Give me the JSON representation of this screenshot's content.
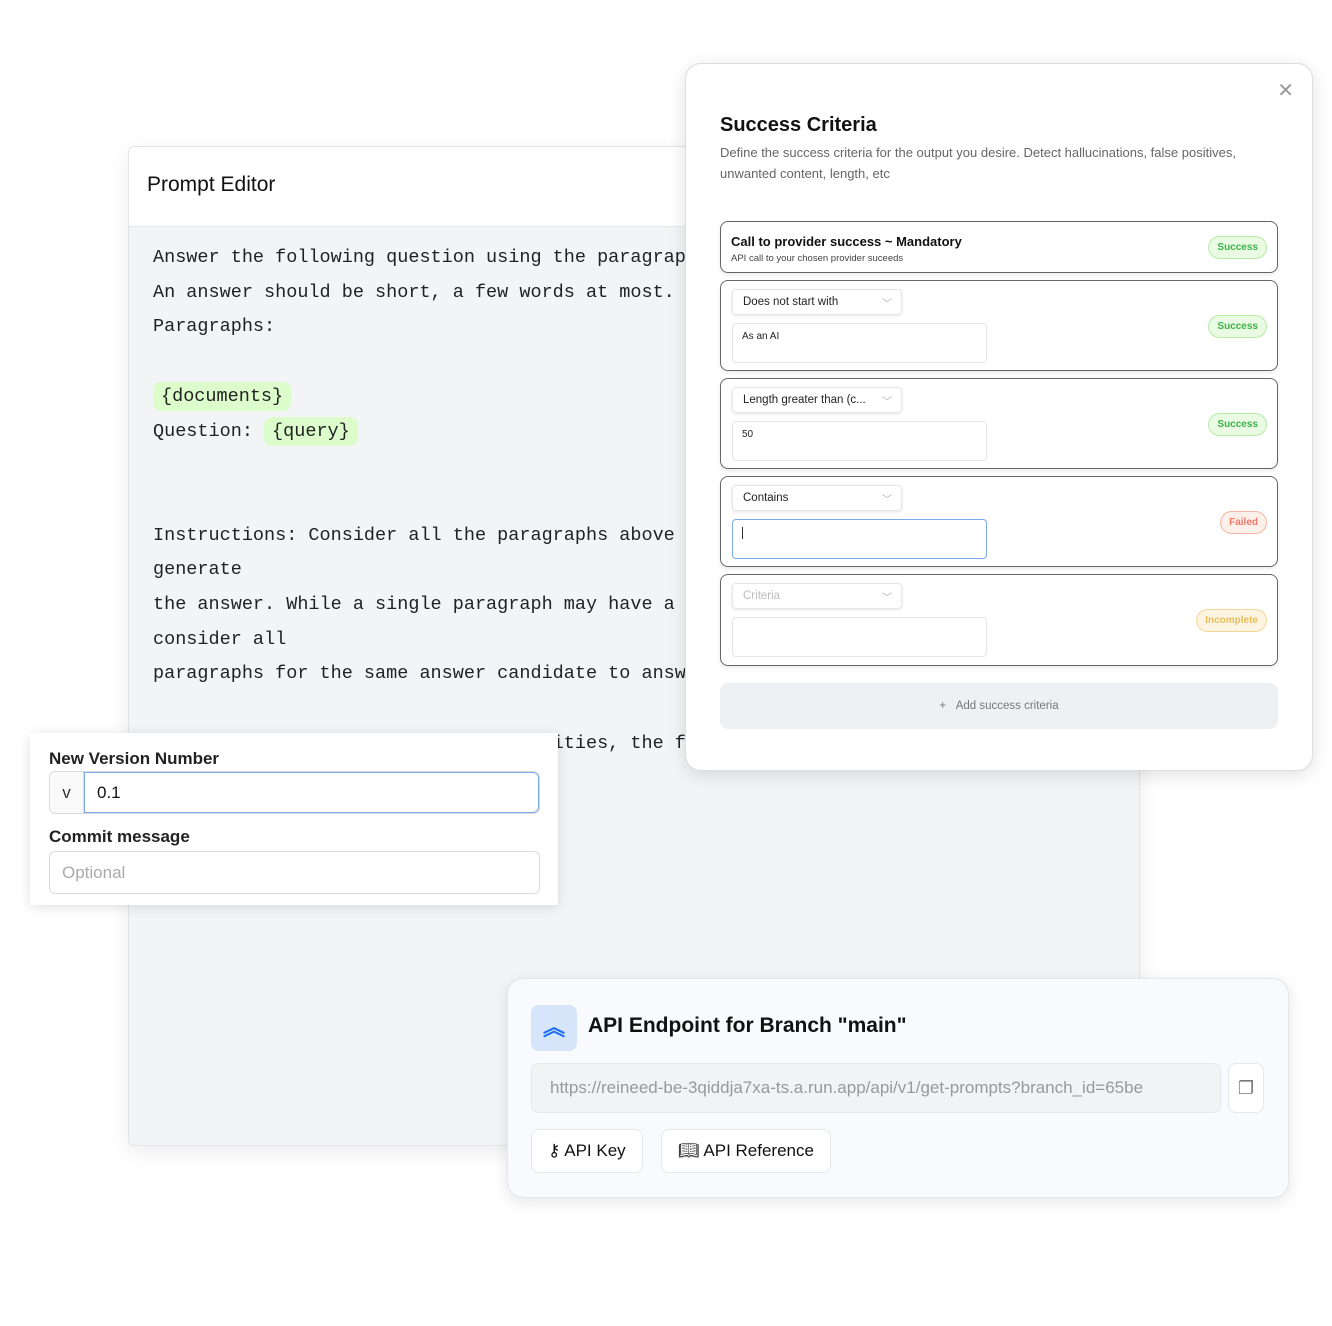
{
  "editor": {
    "title": "Prompt Editor",
    "lines": [
      "Answer the following question using the paragraphs",
      "An answer should be short, a few words at most.",
      "Paragraphs:",
      "",
      "{documents}",
      "Question: {query}",
      "",
      "Instructions: Consider all the paragraphs above",
      "generate",
      "the answer. While a single paragraph may have a",
      "consider all",
      "paragraphs for the same answer candidate to answ",
      "",
      "After having considered all possibilities, the f"
    ],
    "var_documents": "{documents}",
    "question_label": "Question: ",
    "var_query": "{query}"
  },
  "success_criteria": {
    "title": "Success Criteria",
    "description": "Define the success criteria for the output you desire. Detect hallucinations, false positives, unwanted content, length, etc",
    "close_icon": "close-icon",
    "mandatory": {
      "title": "Call to provider success ~ Mandatory",
      "subtitle": "API call to your chosen provider suceeds",
      "status": "Success"
    },
    "items": [
      {
        "criteria": "Does not start with",
        "value": "As an AI",
        "status": "Success"
      },
      {
        "criteria": "Length greater than (c...",
        "value": "50",
        "status": "Success"
      },
      {
        "criteria": "Contains",
        "value": "",
        "status": "Failed"
      },
      {
        "criteria": "",
        "placeholder": "Criteria",
        "value": "",
        "status": "Incomplete"
      }
    ],
    "add_label": "Add success criteria",
    "add_icon": "plus-icon"
  },
  "version": {
    "number_label": "New Version Number",
    "prefix": "v",
    "number_value": "0.1",
    "commit_label": "Commit message",
    "commit_placeholder": "Optional"
  },
  "api": {
    "title": "API Endpoint for Branch \"main\"",
    "url": "https://reineed-be-3qiddja7xa-ts.a.run.app/api/v1/get-prompts?branch_id=65be",
    "api_key_label": "API Key",
    "api_reference_label": "API Reference",
    "colors": {
      "accent": "#1a6ef5"
    }
  }
}
